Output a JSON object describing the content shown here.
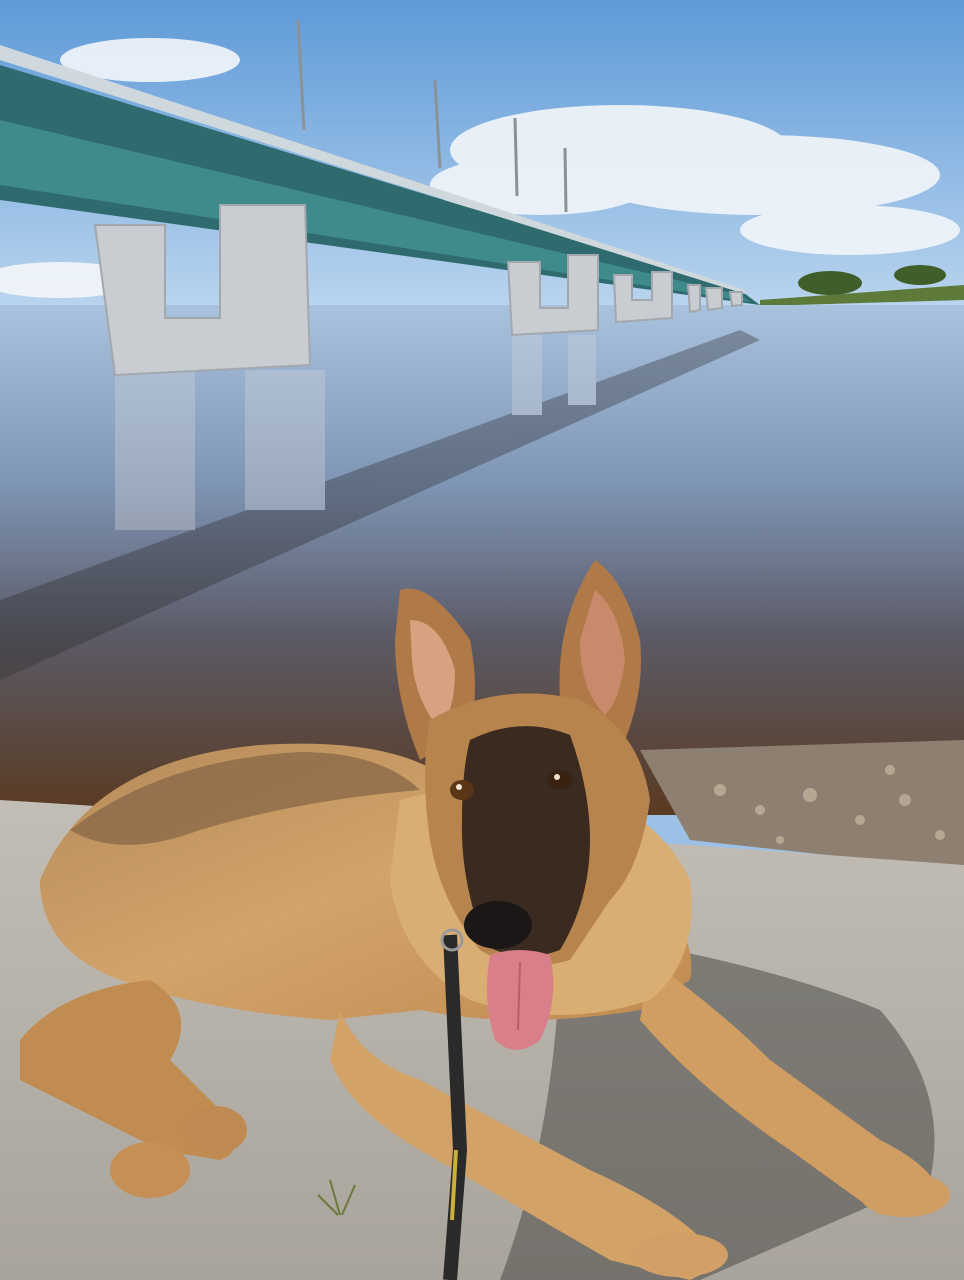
{
  "photo": {
    "subject": "dog",
    "setting": "river-bank-with-bridge",
    "colors": {
      "sky_top": "#5e9ad8",
      "sky_bottom": "#c9def2",
      "cloud": "#f3f6fa",
      "water_top": "#a9c2de",
      "water_mid": "#6a7fa0",
      "water_bottom": "#5a3a22",
      "bridge_deck": "#2f6a6e",
      "bridge_pier": "#c9cdd2",
      "far_shore": "#5d7a3a",
      "pavement": "#b6b2ab",
      "shadow": "#4d4a47",
      "dog_tan": "#c99556",
      "dog_dark": "#3a2a1f",
      "tongue": "#d97f8a",
      "leash": "#2a2a2a"
    }
  }
}
